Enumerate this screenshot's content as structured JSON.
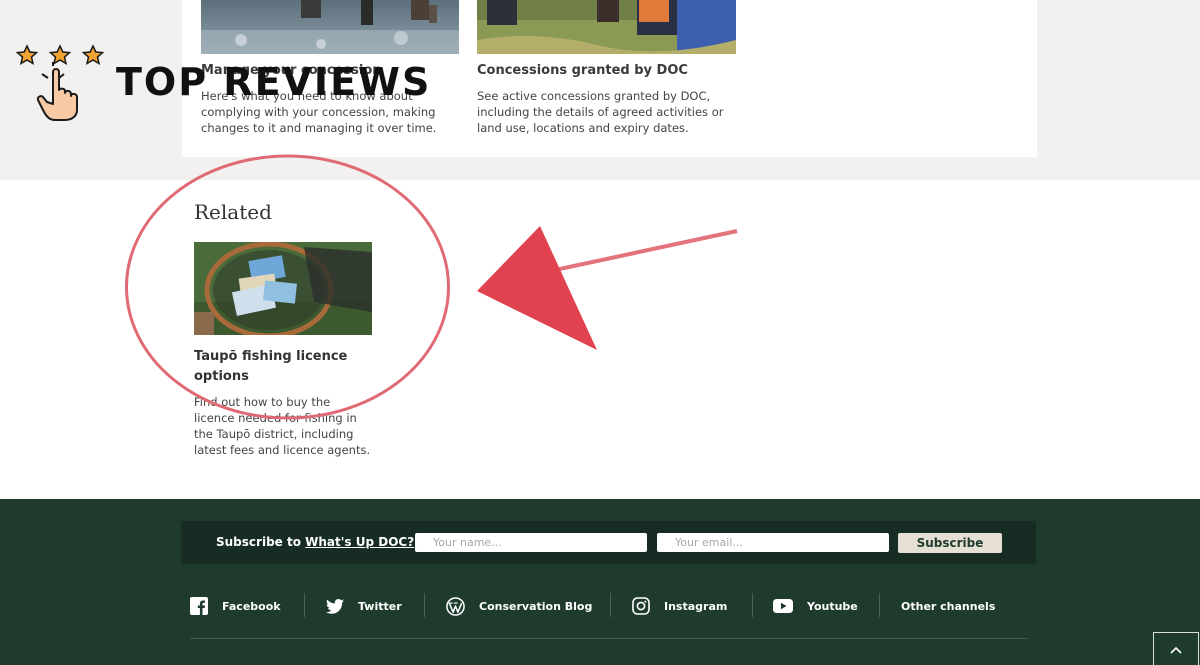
{
  "watermark": {
    "brand": "TOP REVIEWS"
  },
  "tiles": [
    {
      "title": "Manage your concession",
      "text": "Here's what you need to know about complying with your concession, making changes to it and managing it over time."
    },
    {
      "title": "Concessions granted by DOC",
      "text": "See active concessions granted by DOC, including the details of agreed activities or land use, locations and expiry dates."
    }
  ],
  "related": {
    "heading": "Related",
    "item_title": "Taupō fishing licence options",
    "item_text": "Find out how to buy the licence needed for fishing in the Taupō district, including latest fees and licence agents."
  },
  "subscribe": {
    "prefix": "Subscribe to",
    "link": "What's Up DOC?",
    "name_placeholder": "Your name...",
    "email_placeholder": "Your email...",
    "button": "Subscribe"
  },
  "social": [
    {
      "label": "Facebook",
      "icon": "facebook-icon"
    },
    {
      "label": "Twitter",
      "icon": "twitter-icon"
    },
    {
      "label": "Conservation Blog",
      "icon": "wordpress-icon"
    },
    {
      "label": "Instagram",
      "icon": "instagram-icon"
    },
    {
      "label": "Youtube",
      "icon": "youtube-icon"
    },
    {
      "label": "Other channels",
      "icon": ""
    }
  ],
  "colors": {
    "footer": "#1f3b2e",
    "annotation": "#e0434f",
    "star": "#f2a531"
  }
}
